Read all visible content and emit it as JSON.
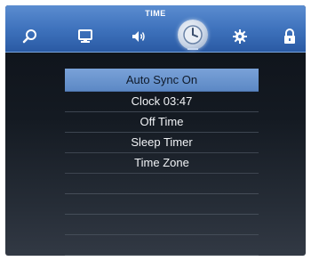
{
  "topbar": {
    "title": "TIME",
    "icons": [
      "search-icon",
      "monitor-icon",
      "speaker-icon",
      "clock-icon",
      "gear-icon",
      "lock-icon"
    ],
    "active_icon": "clock-icon",
    "accent_color": "#3f73bd"
  },
  "menu": {
    "items": [
      {
        "label": "Auto Sync On",
        "selected": true
      },
      {
        "label": "Clock 03:47"
      },
      {
        "label": "Off Time"
      },
      {
        "label": "Sleep Timer"
      },
      {
        "label": "Time Zone"
      }
    ],
    "empty_rows": 4,
    "selected_color": "#6a94cf"
  }
}
